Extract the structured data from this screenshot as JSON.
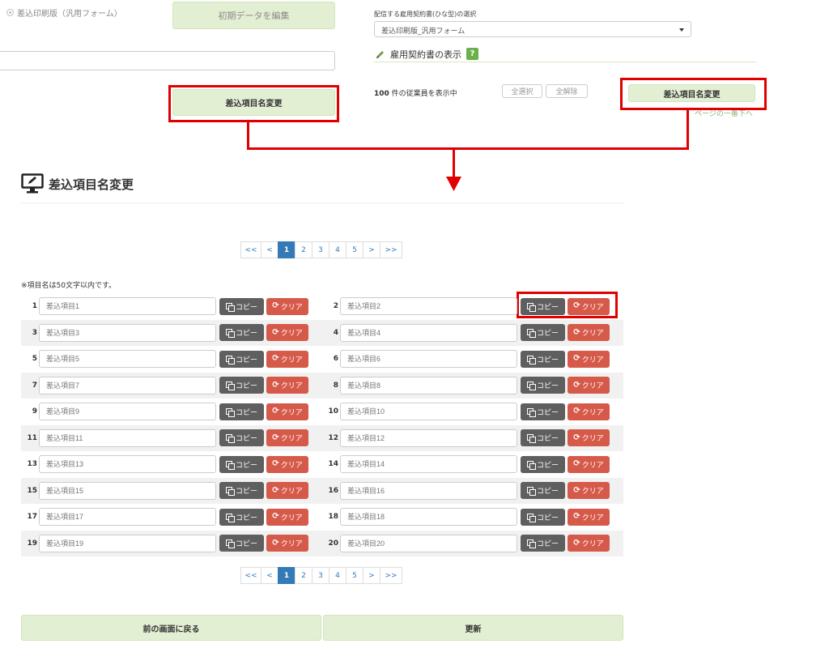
{
  "top": {
    "radio_label": "差込印刷版（汎用フォーム）",
    "edit_initial_data": "初期データを編集",
    "rename_fields_button": "差込項目名変更",
    "template_select_label": "配信する雇用契約書(ひな型)の選択",
    "template_selected": "差込印刷版_汎用フォーム",
    "contract_display_title": "雇用契約書の表示",
    "help_mark": "?",
    "employee_count": "100",
    "employee_count_suffix": " 件の従業員を表示中",
    "select_all": "全選択",
    "deselect_all": "全解除",
    "rename_fields_button_right": "差込項目名変更",
    "page_bottom_link": "ページの一番下へ"
  },
  "section": {
    "title": "差込項目名変更",
    "note": "※項目名は50文字以内です。"
  },
  "pagination": {
    "first": "<<",
    "prev": "<",
    "pages": [
      "1",
      "2",
      "3",
      "4",
      "5"
    ],
    "current": "1",
    "next": ">",
    "last": ">>"
  },
  "fields": [
    {
      "no": "1",
      "placeholder": "差込項目1"
    },
    {
      "no": "2",
      "placeholder": "差込項目2"
    },
    {
      "no": "3",
      "placeholder": "差込項目3"
    },
    {
      "no": "4",
      "placeholder": "差込項目4"
    },
    {
      "no": "5",
      "placeholder": "差込項目5"
    },
    {
      "no": "6",
      "placeholder": "差込項目6"
    },
    {
      "no": "7",
      "placeholder": "差込項目7"
    },
    {
      "no": "8",
      "placeholder": "差込項目8"
    },
    {
      "no": "9",
      "placeholder": "差込項目9"
    },
    {
      "no": "10",
      "placeholder": "差込項目10"
    },
    {
      "no": "11",
      "placeholder": "差込項目11"
    },
    {
      "no": "12",
      "placeholder": "差込項目12"
    },
    {
      "no": "13",
      "placeholder": "差込項目13"
    },
    {
      "no": "14",
      "placeholder": "差込項目14"
    },
    {
      "no": "15",
      "placeholder": "差込項目15"
    },
    {
      "no": "16",
      "placeholder": "差込項目16"
    },
    {
      "no": "17",
      "placeholder": "差込項目17"
    },
    {
      "no": "18",
      "placeholder": "差込項目18"
    },
    {
      "no": "19",
      "placeholder": "差込項目19"
    },
    {
      "no": "20",
      "placeholder": "差込項目20"
    }
  ],
  "row_buttons": {
    "copy": "コピー",
    "clear": "クリア"
  },
  "footer": {
    "back": "前の画面に戻る",
    "update": "更新"
  },
  "colors": {
    "accent_green": "#e3efd3",
    "copy_button": "#5f5f5f",
    "clear_button": "#d65a4a",
    "pager_active": "#337ab7",
    "highlight_red": "#e00000"
  }
}
